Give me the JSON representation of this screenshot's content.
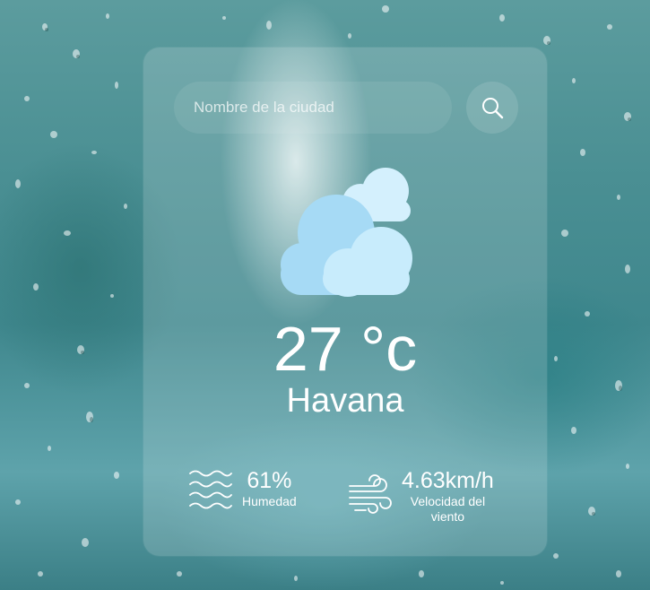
{
  "search": {
    "placeholder": "Nombre de la ciudad",
    "icon": "search-icon"
  },
  "weather": {
    "icon": "cloudy-icon",
    "temperature": "27 °c",
    "city": "Havana"
  },
  "details": {
    "humidity": {
      "icon": "waves-icon",
      "value": "61%",
      "label": "Humedad"
    },
    "wind": {
      "icon": "wind-icon",
      "value": "4.63km/h",
      "label": "Velocidad del viento"
    }
  },
  "colors": {
    "text": "#ffffff",
    "cloud_light": "#cdeefc",
    "cloud_main": "#a8dcf6"
  }
}
